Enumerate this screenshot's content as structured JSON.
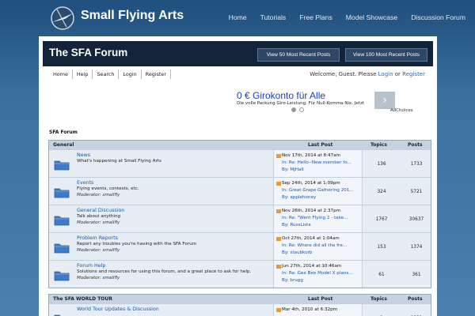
{
  "site": {
    "title": "Small Flying Arts"
  },
  "topnav": [
    "Home",
    "Tutorials",
    "Free Plans",
    "Model Showcase",
    "Discussion Forum"
  ],
  "header": {
    "title": "The SFA Forum",
    "btn50": "View 50 Most Recent Posts",
    "btn100": "View 100 Most Recent Posts"
  },
  "subnav": [
    "Home",
    "Help",
    "Search",
    "Login",
    "Register"
  ],
  "welcome": {
    "prefix": "Welcome, Guest. Please",
    "login": "Login",
    "or": "or",
    "register": "Register"
  },
  "ad": {
    "title": "0 € Girokonto für Alle",
    "subtitle": "Die volle Packung Giro-Leistung. Für Null-Komma-Nix. Jetzt",
    "choices": "AdChoices"
  },
  "breadcrumb": "SFA Forum",
  "general": {
    "headers": {
      "name": "General",
      "lastpost": "Last Post",
      "topics": "Topics",
      "posts": "Posts"
    },
    "rows": [
      {
        "name": "News",
        "desc": "What's happening at Small Flying Arts",
        "mod": "",
        "date": "Nov 17th, 2014 at 8:47am",
        "link": "In: Re: Hello--New member fo...",
        "by": "By: MJHall",
        "topics": "136",
        "posts": "1733"
      },
      {
        "name": "Events",
        "desc": "Flying events, contests, etc.",
        "mod": "Moderator: smallfly",
        "date": "Sep 24th, 2014 at 1:09pm",
        "link": "In: Great Grape Gathering 201...",
        "by": "By: applehoney",
        "topics": "324",
        "posts": "5721"
      },
      {
        "name": "General Discussion",
        "desc": "Talk about anything",
        "mod": "Moderator: smallfly",
        "date": "Nov 26th, 2014 at 2:37pm",
        "link": "In: Re: \"Went Flying 2 - take...",
        "by": "By: RussLista",
        "topics": "1767",
        "posts": "30637"
      },
      {
        "name": "Problem Reports",
        "desc": "Report any troubles you're having with the SFA Forum",
        "mod": "Moderator: smallfly",
        "date": "Oct 27th, 2014 at 1:04am",
        "link": "In: Re: Where did all the fre...",
        "by": "By: staubkorb",
        "topics": "153",
        "posts": "1374"
      },
      {
        "name": "Forum Help",
        "desc": "Solutions and resources for using this forum, and a great place to ask for help.",
        "mod": "Moderator: smallfly",
        "date": "Jun 27th, 2014 at 10:46am",
        "link": "In: Re: Gee Bee Model X plans...",
        "by": "By: brugg",
        "topics": "61",
        "posts": "361"
      }
    ]
  },
  "tour": {
    "headers": {
      "name": "The SFA WORLD TOUR",
      "lastpost": "Last Post",
      "topics": "Topics",
      "posts": "Posts"
    },
    "rows": [
      {
        "name": "World Tour Updates & Discussion",
        "desc": "",
        "mod": "",
        "date": "Mar 4th, 2010 at 6:32pm",
        "link": "",
        "by": "",
        "topics": "1",
        "posts": "1231"
      }
    ]
  }
}
